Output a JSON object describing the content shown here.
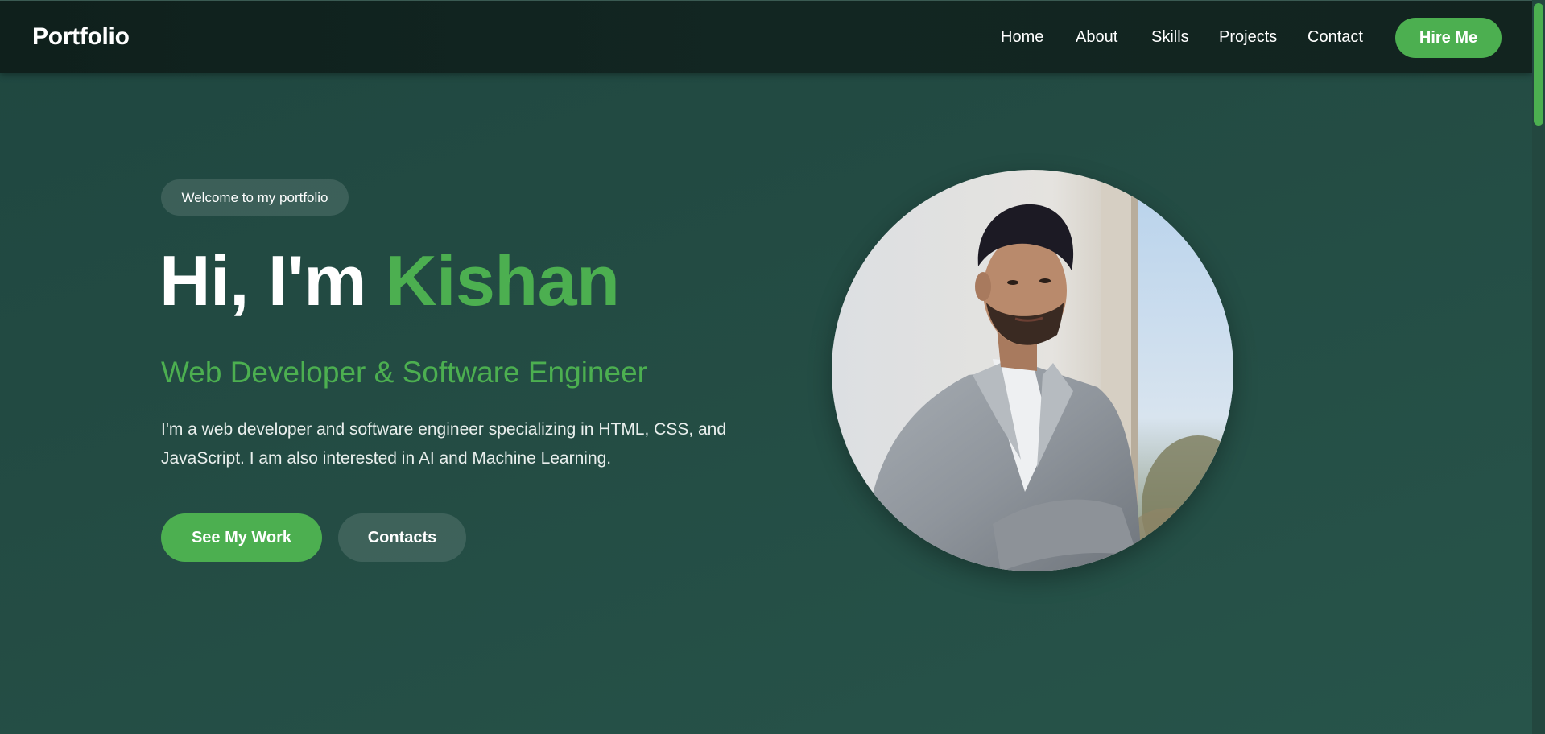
{
  "nav": {
    "brand": "Portfolio",
    "links": [
      "Home",
      "About",
      "Skills",
      "Projects",
      "Contact"
    ],
    "cta": "Hire Me"
  },
  "hero": {
    "badge": "Welcome to my portfolio",
    "greeting": "Hi, I'm ",
    "name": "Kishan",
    "subtitle": "Web Developer & Software Engineer",
    "description": "I'm a web developer and software engineer specializing in HTML, CSS, and JavaScript. I am also interested in AI and Machine Learning.",
    "primary_button": "See My Work",
    "secondary_button": "Contacts"
  },
  "colors": {
    "accent": "#4caf50",
    "background": "#234b43",
    "navbar": "#11231f"
  },
  "icons": [
    "profile-photo"
  ]
}
